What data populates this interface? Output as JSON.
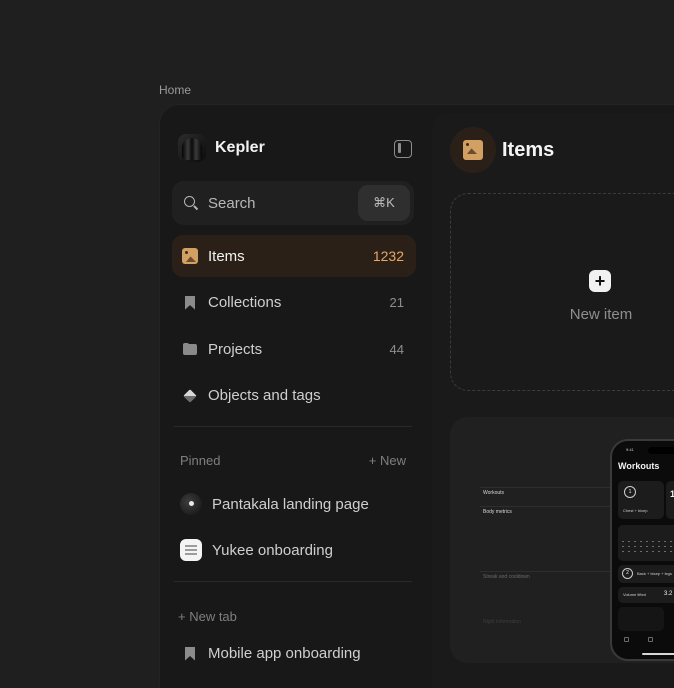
{
  "breadcrumb": "Home",
  "app": {
    "name": "Kepler"
  },
  "search": {
    "label": "Search",
    "shortcut": "⌘K"
  },
  "nav": [
    {
      "label": "Items",
      "count": "1232",
      "icon": "image-icon",
      "active": true
    },
    {
      "label": "Collections",
      "count": "21",
      "icon": "bookmark-icon"
    },
    {
      "label": "Projects",
      "count": "44",
      "icon": "folder-icon"
    },
    {
      "label": "Objects and tags",
      "count": "",
      "icon": "box-icon"
    }
  ],
  "pinned": {
    "title": "Pinned",
    "new_label": "+ New",
    "items": [
      {
        "label": "Pantakala landing page",
        "icon": "pantakala-icon"
      },
      {
        "label": "Yukee onboarding",
        "icon": "yukee-icon"
      }
    ]
  },
  "new_tab_label": "+ New  tab",
  "bottom_item": {
    "label": "Mobile app onboarding",
    "icon": "bookmark-icon"
  },
  "main": {
    "title": "Items",
    "new_item_label": "New item",
    "preview": {
      "rows": [
        "Workouts",
        "Body metrics",
        "Streak and cooldown",
        "Night information"
      ],
      "phone": {
        "time": "9:41",
        "title": "Workouts",
        "tile1": "Chest + bicep",
        "tile2": "Back + bicep + legs",
        "volume_label": "Volume lifted",
        "volume_value": "3.2",
        "ring1": "1",
        "ring2": "2",
        "big": "1"
      }
    }
  },
  "colors": {
    "accent": "#e7a866",
    "active_bg": "#2a2018",
    "background": "#1f1f1f"
  }
}
